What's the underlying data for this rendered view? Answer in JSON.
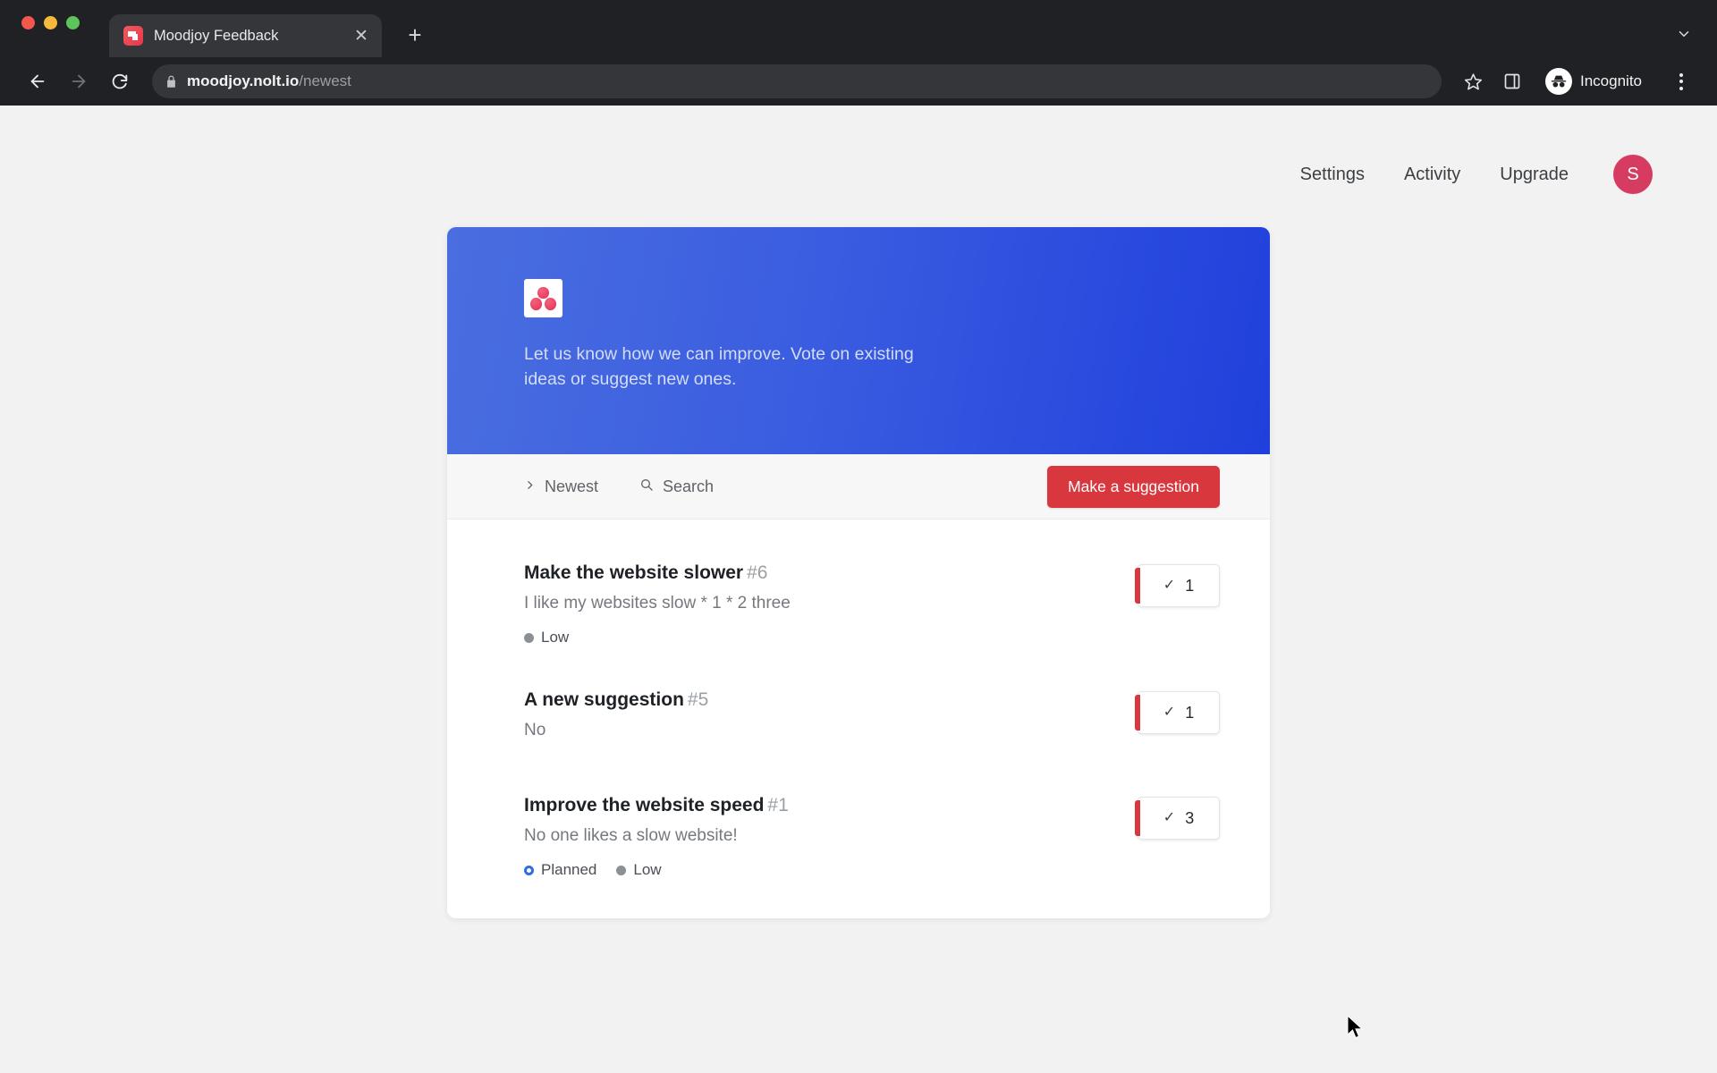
{
  "browser": {
    "tab": {
      "title": "Moodjoy Feedback",
      "favicon_name": "moodjoy-favicon",
      "close_label": "✕"
    },
    "new_tab_label": "+",
    "tabstrip_dropdown_name": "tab-list-chevron-icon",
    "url": {
      "domain": "moodjoy.nolt.io",
      "path": "/newest",
      "lock_icon": "lock-icon"
    },
    "back_label": "←",
    "forward_label": "→",
    "reload_label": "⟳",
    "bookmark_icon": "star-icon",
    "sidepanel_icon": "side-panel-icon",
    "profile": {
      "label": "Incognito",
      "icon": "incognito-icon"
    },
    "menu_icon": "kebab-menu-icon"
  },
  "topnav": {
    "links": [
      {
        "label": "Settings",
        "name": "nav-settings"
      },
      {
        "label": "Activity",
        "name": "nav-activity"
      },
      {
        "label": "Upgrade",
        "name": "nav-upgrade"
      }
    ],
    "avatar_initial": "S",
    "avatar_color": "#d63b62"
  },
  "board": {
    "header": {
      "description": "Let us know how we can improve. Vote on existing ideas or suggest new ones.",
      "gradient_from": "#4a6ee0",
      "gradient_to": "#2040dc",
      "logo_name": "moodjoy-logo"
    },
    "toolbar": {
      "sort": {
        "label": "Newest",
        "icon": "chevron-right-icon"
      },
      "search": {
        "label": "Search",
        "icon": "search-icon"
      },
      "cta": {
        "label": "Make a suggestion",
        "color": "#d9373e"
      }
    },
    "items": [
      {
        "title": "Make the website slower",
        "number": "#6",
        "description": "I like my websites slow * 1 * 2 three",
        "tags": [
          {
            "label": "Low",
            "type": "low"
          }
        ],
        "votes": "1",
        "vote_icon": "✓"
      },
      {
        "title": "A new suggestion",
        "number": "#5",
        "description": "No",
        "tags": [],
        "votes": "1",
        "vote_icon": "✓"
      },
      {
        "title": "Improve the website speed",
        "number": "#1",
        "description": "No one likes a slow website!",
        "tags": [
          {
            "label": "Planned",
            "type": "planned"
          },
          {
            "label": "Low",
            "type": "low"
          }
        ],
        "votes": "3",
        "vote_icon": "✓"
      }
    ]
  }
}
